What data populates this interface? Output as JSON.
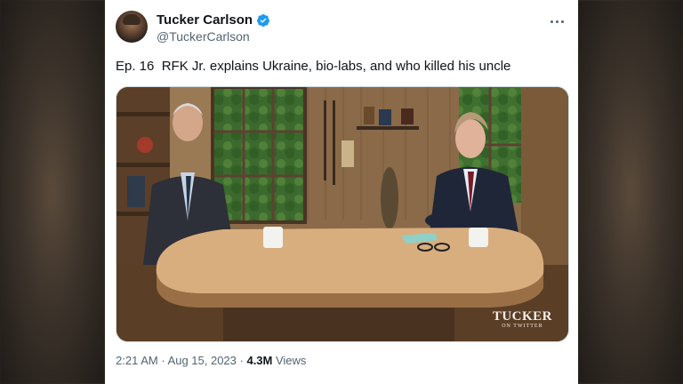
{
  "user": {
    "display_name": "Tucker Carlson",
    "handle": "@TuckerCarlson",
    "verified": true,
    "avatar_icon": "avatar-photo"
  },
  "tweet": {
    "text": "Ep. 16  RFK Jr. explains Ukraine, bio-labs, and who killed his uncle"
  },
  "media": {
    "watermark_title": "TUCKER",
    "watermark_subtitle": "ON TWITTER"
  },
  "meta": {
    "time": "2:21 AM",
    "separator": " · ",
    "date": "Aug 15, 2023",
    "views_count": "4.3M",
    "views_label": " Views"
  },
  "colors": {
    "verified": "#1d9bf0",
    "secondary_text": "#536471",
    "primary_text": "#0f1419"
  }
}
